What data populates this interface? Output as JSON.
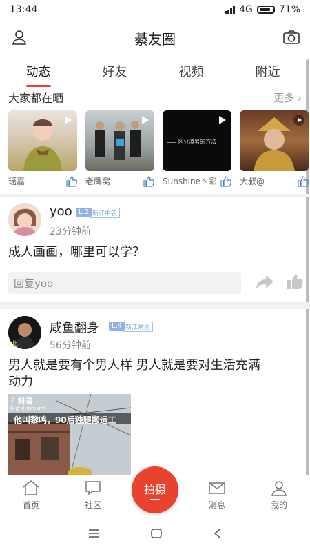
{
  "status": {
    "time": "13:44",
    "network": "4G",
    "battery": "71%"
  },
  "header": {
    "title": "綦友圈"
  },
  "tabs": [
    {
      "label": "动态",
      "active": true
    },
    {
      "label": "好友",
      "active": false
    },
    {
      "label": "视频",
      "active": false
    },
    {
      "label": "附近",
      "active": false
    }
  ],
  "share_section": {
    "label": "大家都在晒",
    "more": "更多",
    "items": [
      {
        "name": "瑶嘉"
      },
      {
        "name": "老鹰窝"
      },
      {
        "name": "Sunshine丶彩",
        "overlay_text": "区分渣男的方法"
      },
      {
        "name": "大叔@"
      }
    ]
  },
  "posts": [
    {
      "username": "yoo",
      "level": "L.2",
      "level_tag": "新江中农",
      "time": "23分钟前",
      "text": "成人画画，哪里可以学？",
      "reply_placeholder": "回复yoo"
    },
    {
      "username": "咸鱼翻身",
      "level": "L.4",
      "level_tag": "新江财主",
      "time": "56分钟前",
      "text_line1": "男人就是要有个男人样 男人就是要对生活充满",
      "text_line2": "动力",
      "video": {
        "platform": "抖音",
        "account": "抖音号:mrbxmt",
        "caption": "他叫黎鸣，90后独腿搬运工"
      }
    }
  ],
  "bottom_nav": [
    {
      "label": "首页",
      "icon": "home-icon"
    },
    {
      "label": "社区",
      "icon": "chat-icon"
    },
    {
      "label": "拍摄",
      "icon": "shoot-icon"
    },
    {
      "label": "消息",
      "icon": "mail-icon"
    },
    {
      "label": "我的",
      "icon": "person-icon"
    }
  ],
  "colors": {
    "accent": "#e8432f",
    "level_badge": "#8fb4e3"
  }
}
